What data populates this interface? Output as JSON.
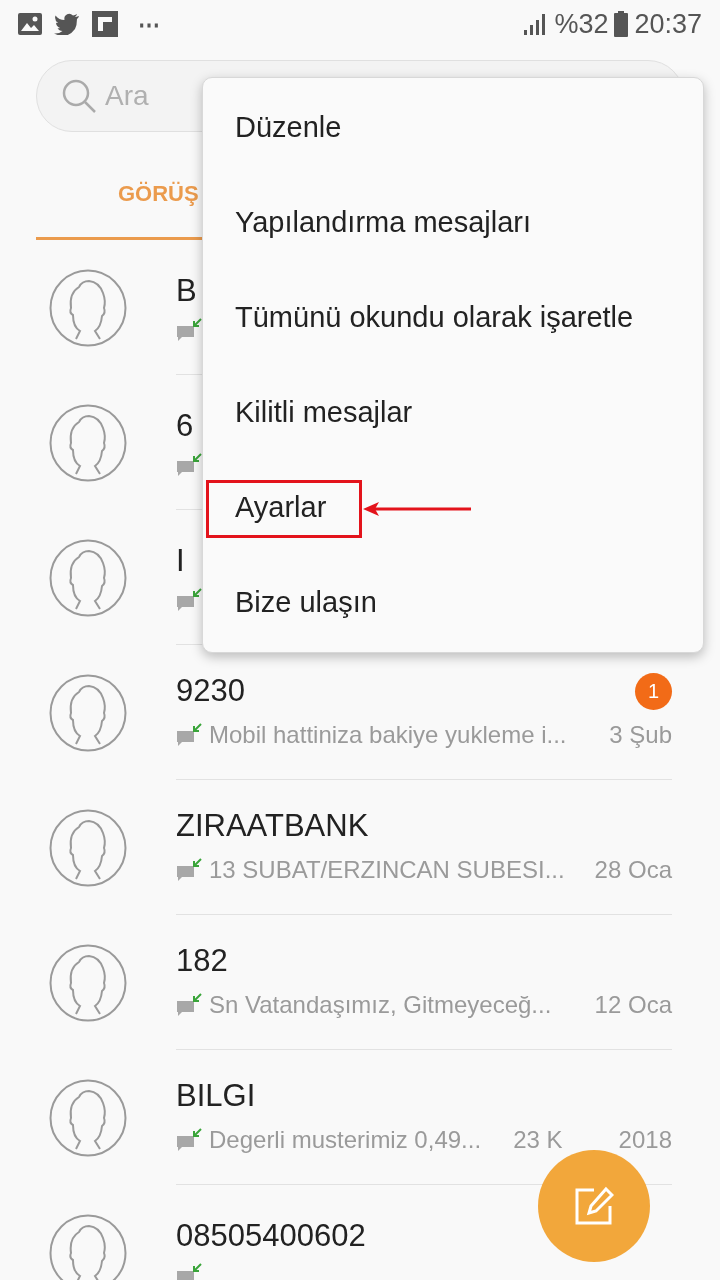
{
  "status_bar": {
    "more": "⋯",
    "battery_percent": "%32",
    "time": "20:37"
  },
  "search": {
    "placeholder": "Ara"
  },
  "tabs": [
    {
      "label": "GÖRÜŞ",
      "selected": true
    }
  ],
  "conversations": [
    {
      "name": "B"
    },
    {
      "name": "6"
    },
    {
      "name": "I"
    },
    {
      "name": "9230",
      "preview": "Mobil hattiniza bakiye yukleme i...",
      "date": "3 Şub",
      "unread": "1"
    },
    {
      "name": "ZIRAATBANK",
      "preview": "13 SUBAT/ERZINCAN SUBESI...",
      "date": "28 Oca"
    },
    {
      "name": "182",
      "preview": "Sn Vatandaşımız, Gitmeyeceğ...",
      "date": "12 Oca"
    },
    {
      "name": "BILGI",
      "preview": "Degerli musterimiz 0,49...",
      "date": "23 K",
      "year": "2018"
    },
    {
      "name": "08505400602"
    }
  ],
  "menu": [
    {
      "label": "Düzenle",
      "highlighted": false
    },
    {
      "label": "Yapılandırma mesajları",
      "highlighted": false
    },
    {
      "label": "Tümünü okundu olarak işaretle",
      "highlighted": false
    },
    {
      "label": "Kilitli mesajlar",
      "highlighted": false
    },
    {
      "label": "Ayarlar",
      "highlighted": true
    },
    {
      "label": "Bize ulaşın",
      "highlighted": false
    }
  ]
}
